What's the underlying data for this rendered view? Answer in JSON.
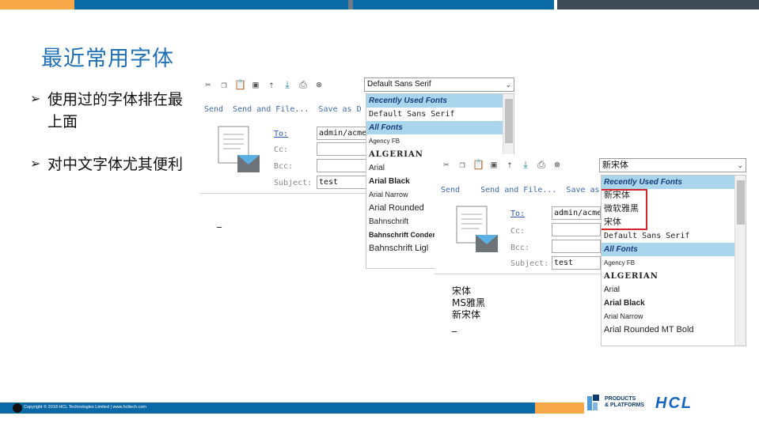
{
  "topbar": {
    "colors": [
      "#f7a94a",
      "#0a6aa6",
      "#6e7c87",
      "#0a6aa6",
      "#3c4a55"
    ]
  },
  "slide": {
    "title": "最近常用字体",
    "bullets": [
      {
        "text": "使用过的字体排在最上面"
      },
      {
        "text": "对中文字体尤其便利"
      }
    ]
  },
  "panel1": {
    "font_select": "Default Sans Serif",
    "actions": [
      "Send",
      "Send and File...",
      "Save as D"
    ],
    "fields": {
      "to_label": "To:",
      "cc_label": "Cc:",
      "bcc_label": "Bcc:",
      "subject_label": "Subject:",
      "to_value": "admin/acme",
      "subject_value": "test"
    },
    "dropdown": {
      "recent_header": "Recently Used Fonts",
      "recent_items": [
        "Default Sans Serif"
      ],
      "all_header": "All Fonts",
      "all_items": [
        "Agency FB",
        "ALGERIAN",
        "Arial",
        "Arial Black",
        "Arial Narrow",
        "Arial Rounded",
        "Bahnschrift",
        "Bahnschrift Condens",
        "Bahnschrift Ligl"
      ]
    },
    "body_cursor": "_"
  },
  "panel2": {
    "font_select": "新宋体",
    "actions": [
      "Send",
      "Send and File...",
      "Save as"
    ],
    "fields": {
      "to_label": "To:",
      "cc_label": "Cc:",
      "bcc_label": "Bcc:",
      "subject_label": "Subject:",
      "to_value": "admin/acme",
      "subject_value": "test"
    },
    "dropdown": {
      "recent_header": "Recently Used Fonts",
      "recent_items": [
        "新宋体",
        "微软雅黑",
        "宋体",
        "Default Sans Serif"
      ],
      "all_header": "All Fonts",
      "all_items": [
        "Agency FB",
        "ALGERIAN",
        "Arial",
        "Arial Black",
        "Arial Narrow",
        "Arial Rounded MT Bold"
      ]
    },
    "body_lines": [
      "宋体",
      "MS雅黑",
      "新宋体",
      "_"
    ]
  },
  "footer": {
    "copyright": "Copyright © 2018 HCL Technologies Limited  |  www.hcltech.com",
    "products_logo": [
      "PRODUCTS",
      "& PLATFORMS"
    ],
    "hcl_logo": "HCL"
  }
}
